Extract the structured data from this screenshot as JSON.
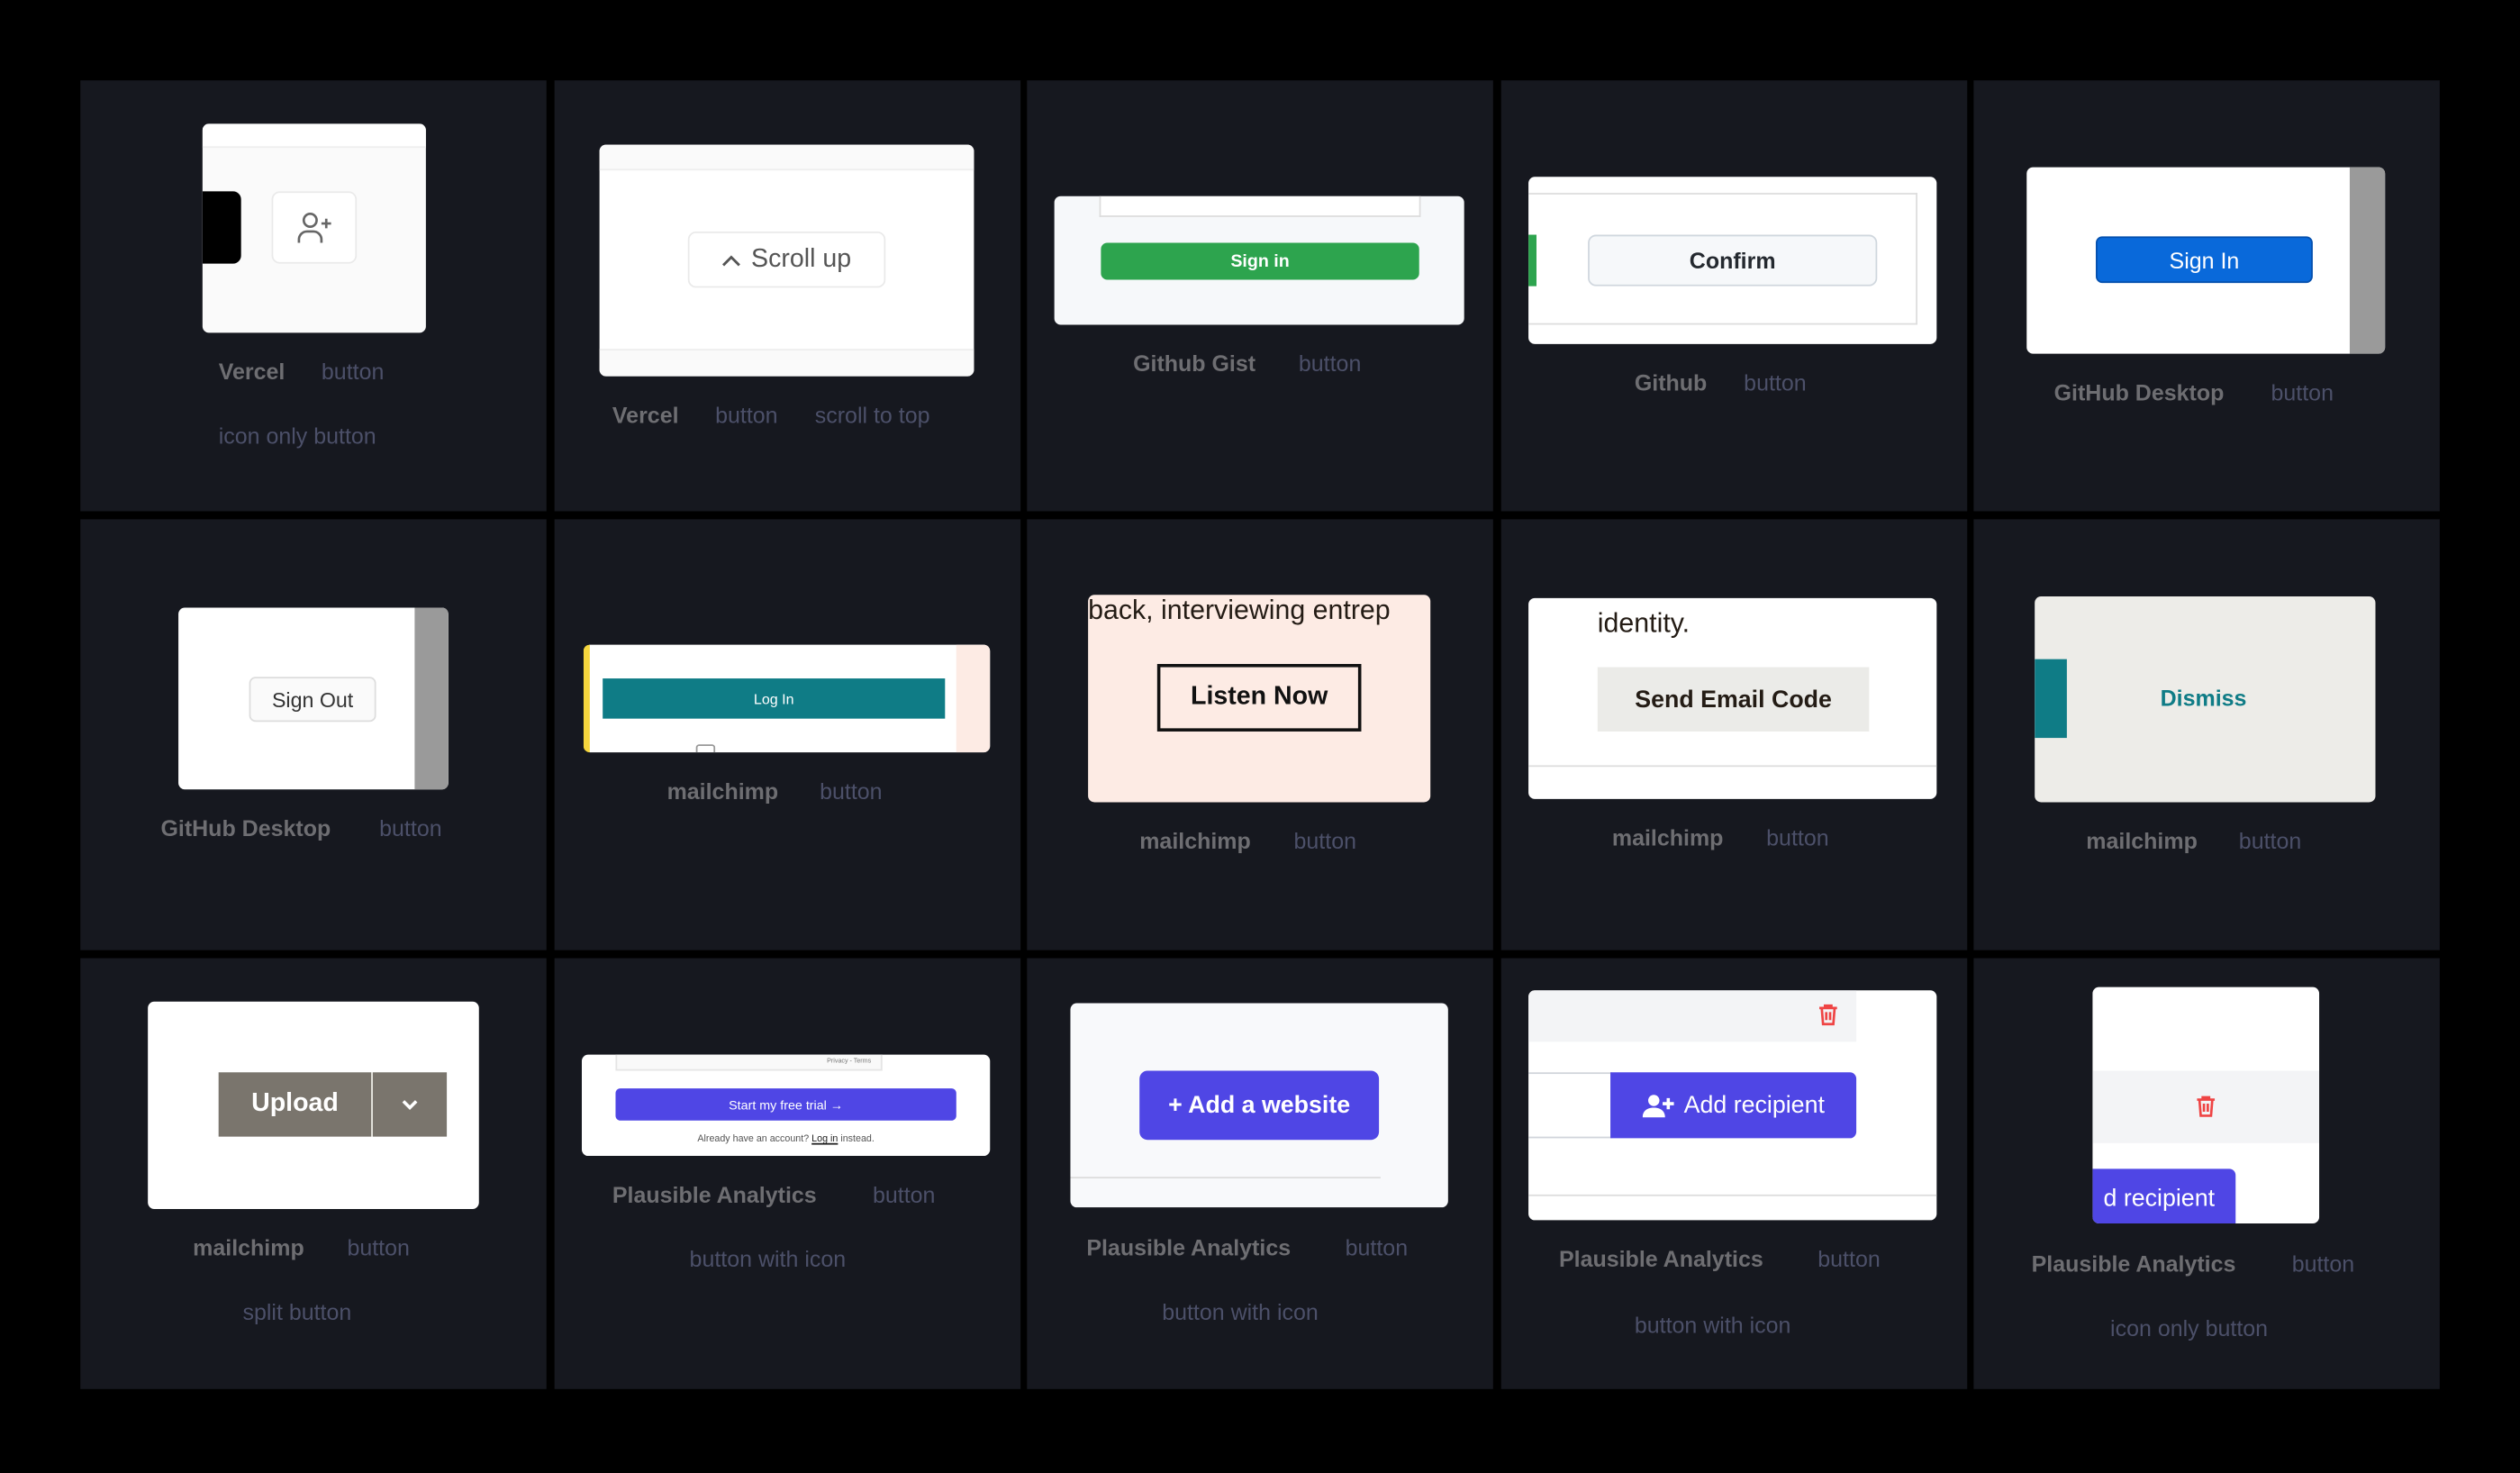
{
  "cards": [
    {
      "source": "Vercel",
      "type": "button",
      "tag": "icon only button",
      "icon": "user-plus-icon"
    },
    {
      "source": "Vercel",
      "type": "button",
      "tag": "scroll to top",
      "label": "Scroll up",
      "icon": "chevron-up-icon"
    },
    {
      "source": "Github Gist",
      "type": "button",
      "label": "Sign in",
      "color": "#2da44e"
    },
    {
      "source": "Github",
      "type": "button",
      "label": "Confirm"
    },
    {
      "source": "GitHub Desktop",
      "type": "button",
      "label": "Sign In",
      "color": "#0969da"
    },
    {
      "source": "GitHub Desktop",
      "type": "button",
      "label": "Sign Out"
    },
    {
      "source": "mailchimp",
      "type": "button",
      "label": "Log In",
      "color": "#0f7c86"
    },
    {
      "source": "mailchimp",
      "type": "button",
      "label": "Listen Now",
      "context": "back, interviewing entrep"
    },
    {
      "source": "mailchimp",
      "type": "button",
      "label": "Send Email Code",
      "context": "identity."
    },
    {
      "source": "mailchimp",
      "type": "button",
      "label": "Dismiss"
    },
    {
      "source": "mailchimp",
      "type": "button",
      "tag": "split button",
      "label": "Upload",
      "icon": "chevron-down-icon"
    },
    {
      "source": "Plausible Analytics",
      "type": "button",
      "tag": "button with icon",
      "label": "Start my free trial →",
      "legal": "Privacy - Terms",
      "footer_pre": "Already have an account?",
      "footer_link": "Log in",
      "footer_post": "instead.",
      "color": "#4f46e5"
    },
    {
      "source": "Plausible Analytics",
      "type": "button",
      "tag": "button with icon",
      "label": "+ Add a website",
      "color": "#4f46e5"
    },
    {
      "source": "Plausible Analytics",
      "type": "button",
      "tag": "button with icon",
      "label": "Add recipient",
      "icon": "trash-icon"
    },
    {
      "source": "Plausible Analytics",
      "type": "button",
      "tag": "icon only button",
      "label": "d recipient",
      "icon": "trash-icon"
    }
  ]
}
